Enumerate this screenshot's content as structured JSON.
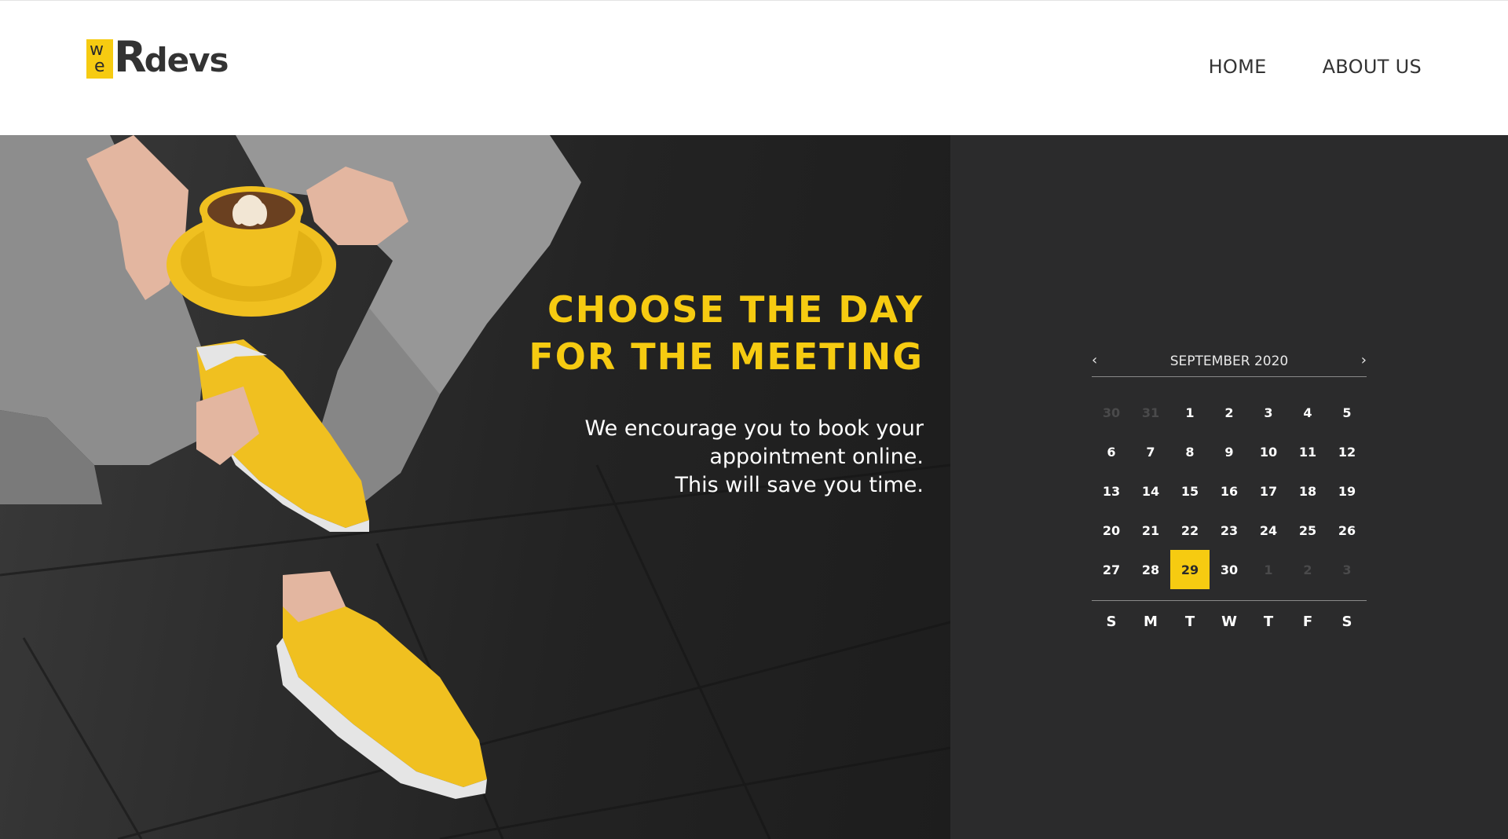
{
  "header": {
    "logo": {
      "w": "w",
      "e": "e",
      "big": "R",
      "rest": "devs"
    },
    "nav": [
      "HOME",
      "ABOUT US"
    ]
  },
  "hero": {
    "title_line1": "CHOOSE THE DAY",
    "title_line2": "FOR THE MEETING",
    "subtitle_line1": "We encourage you to book your",
    "subtitle_line2": "appointment online.",
    "subtitle_line3": "This will save you time."
  },
  "calendar": {
    "month_label": "SEPTEMBER 2020",
    "prev": "‹",
    "next": "›",
    "days": [
      {
        "d": "30",
        "muted": true
      },
      {
        "d": "31",
        "muted": true
      },
      {
        "d": "1"
      },
      {
        "d": "2"
      },
      {
        "d": "3"
      },
      {
        "d": "4"
      },
      {
        "d": "5"
      },
      {
        "d": "6"
      },
      {
        "d": "7"
      },
      {
        "d": "8"
      },
      {
        "d": "9"
      },
      {
        "d": "10"
      },
      {
        "d": "11"
      },
      {
        "d": "12"
      },
      {
        "d": "13"
      },
      {
        "d": "14"
      },
      {
        "d": "15"
      },
      {
        "d": "16"
      },
      {
        "d": "17"
      },
      {
        "d": "18"
      },
      {
        "d": "19"
      },
      {
        "d": "20"
      },
      {
        "d": "21"
      },
      {
        "d": "22"
      },
      {
        "d": "23"
      },
      {
        "d": "24"
      },
      {
        "d": "25"
      },
      {
        "d": "26"
      },
      {
        "d": "27"
      },
      {
        "d": "28"
      },
      {
        "d": "29",
        "selected": true
      },
      {
        "d": "30"
      },
      {
        "d": "1",
        "muted": true
      },
      {
        "d": "2",
        "muted": true
      },
      {
        "d": "3",
        "muted": true
      }
    ],
    "weekdays": [
      "S",
      "M",
      "T",
      "W",
      "T",
      "F",
      "S"
    ]
  },
  "colors": {
    "accent": "#f6cb11",
    "panel": "#2b2b2c",
    "text_dark": "#333333"
  }
}
